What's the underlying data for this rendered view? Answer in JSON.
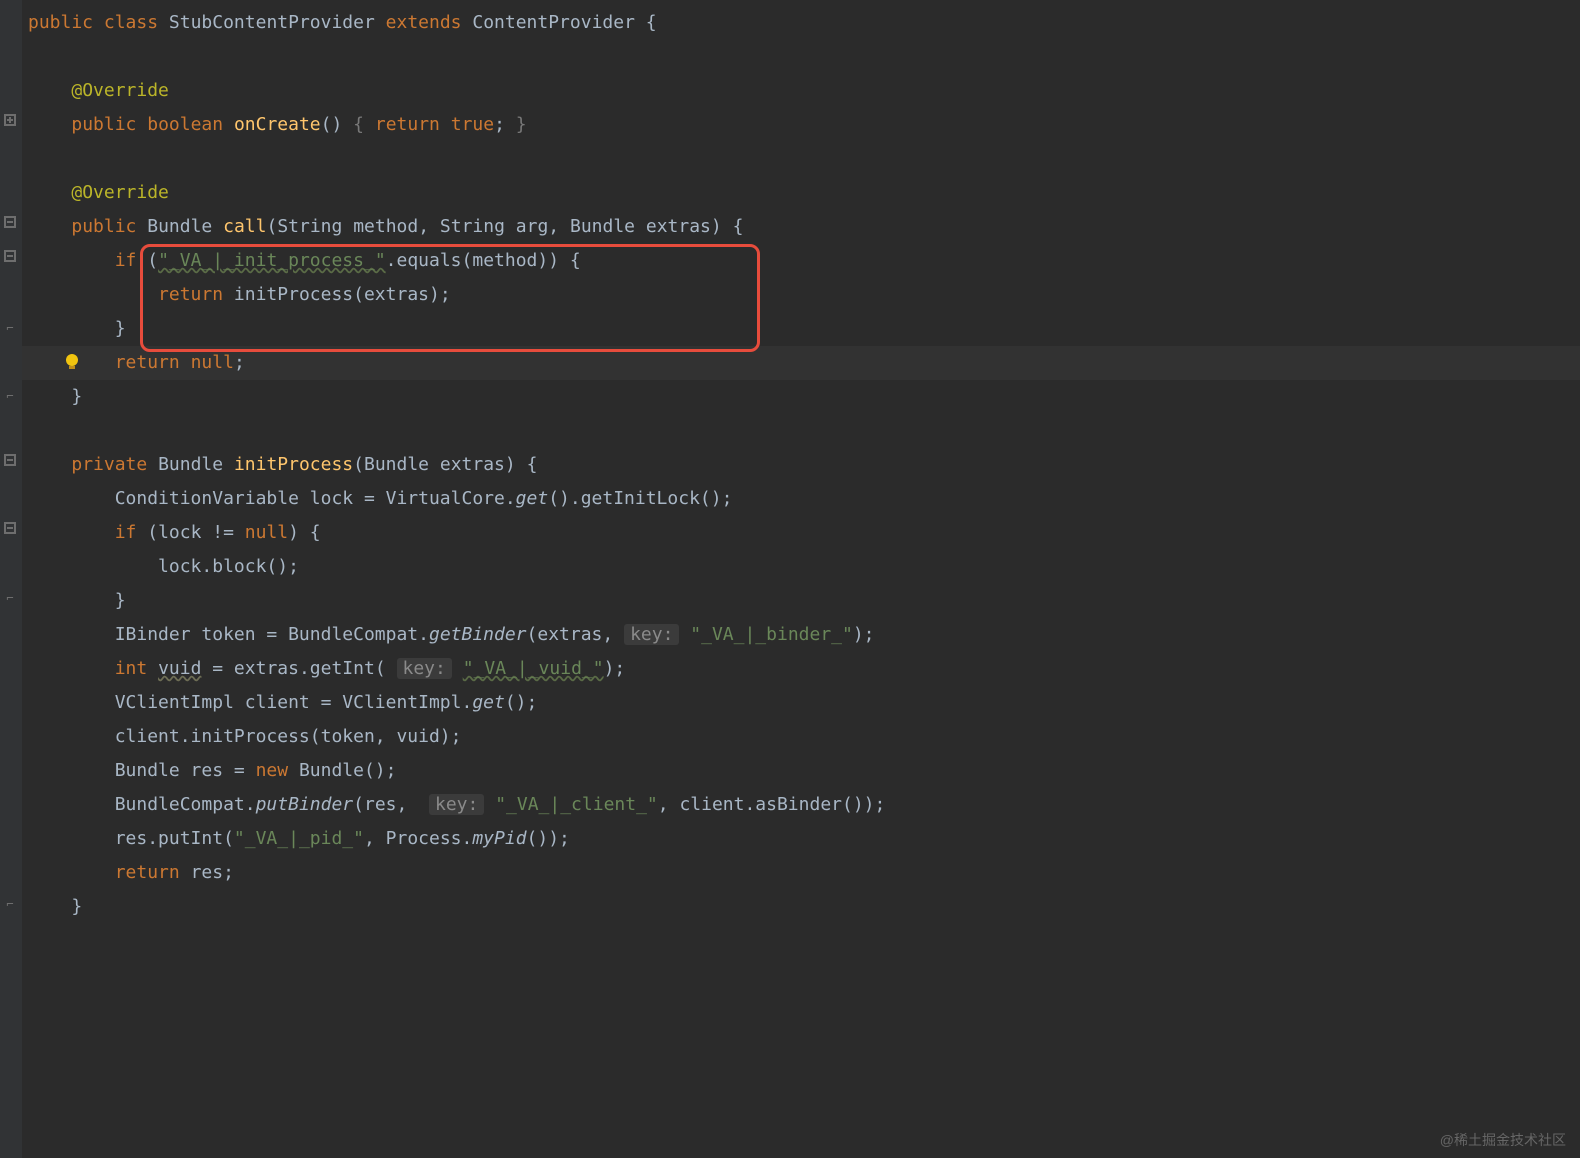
{
  "code": {
    "classDecl": {
      "pub": "public",
      "cls": "class",
      "name": "StubContentProvider",
      "ext": "extends",
      "base": "ContentProvider",
      "ob": "{"
    },
    "override1": "@Override",
    "onCreate": {
      "pub": "public",
      "bool": "boolean",
      "name": "onCreate",
      "parens": "()",
      "body": "{ ",
      "ret": "return",
      "val": "true",
      "semi": ";",
      "cb": " }"
    },
    "override2": "@Override",
    "callSig": {
      "pub": "public",
      "ret": "Bundle",
      "name": "call",
      "open": "(",
      "p1t": "String",
      "p1n": "method",
      "c1": ", ",
      "p2t": "String",
      "p2n": "arg",
      "c2": ", ",
      "p3t": "Bundle",
      "p3n": "extras",
      "close": ")",
      "ob": " {"
    },
    "ifLine": {
      "if": "if",
      "open": " (",
      "str": "\"_VA_|_init_process_\"",
      "rest": ".equals(method)) {"
    },
    "retInit": {
      "ret": "return",
      "sp": " ",
      "call": "initProcess(extras)",
      "semi": ";"
    },
    "closeIf": "}",
    "retNull": {
      "ret": "return",
      "sp": " ",
      "val": "null",
      "semi": ";"
    },
    "closeCall": "}",
    "initSig": {
      "priv": "private",
      "ret": "Bundle",
      "name": "initProcess",
      "open": "(",
      "pt": "Bundle",
      "pn": "extras",
      "close": ")",
      "ob": " {"
    },
    "l1": {
      "a": "ConditionVariable lock = VirtualCore.",
      "get": "get",
      "b": "().getInitLock();"
    },
    "l2": {
      "if": "if",
      "rest": " (lock != ",
      "nul": "null",
      "close": ") {"
    },
    "l3": "lock.block();",
    "l4": "}",
    "l5": {
      "a": "IBinder token = BundleCompat.",
      "gb": "getBinder",
      "b": "(extras, ",
      "hint": "key:",
      "sp": " ",
      "str": "\"_VA_|_binder_\"",
      "c": ");"
    },
    "l6": {
      "int": "int",
      "sp": " ",
      "var": "vuid",
      "eq": " = extras.getInt( ",
      "hint": "key:",
      "sp2": " ",
      "str": "\"_VA_|_vuid_\"",
      "c": ");"
    },
    "l7": {
      "a": "VClientImpl client = VClientImpl.",
      "get": "get",
      "b": "();"
    },
    "l8": "client.initProcess(token, vuid);",
    "l9": {
      "a": "Bundle res = ",
      "new": "new",
      "b": " Bundle();"
    },
    "l10": {
      "a": "BundleCompat.",
      "pb": "putBinder",
      "b": "(res,  ",
      "hint": "key:",
      "sp": " ",
      "str": "\"_VA_|_client_\"",
      "c": ", client.asBinder());"
    },
    "l11": {
      "a": "res.putInt(",
      "str": "\"_VA_|_pid_\"",
      "b": ", Process.",
      "mp": "myPid",
      "c": "());"
    },
    "l12": {
      "ret": "return",
      "sp": " ",
      "val": "res;"
    },
    "closeInit": "}"
  },
  "watermark": "@稀土掘金技术社区"
}
